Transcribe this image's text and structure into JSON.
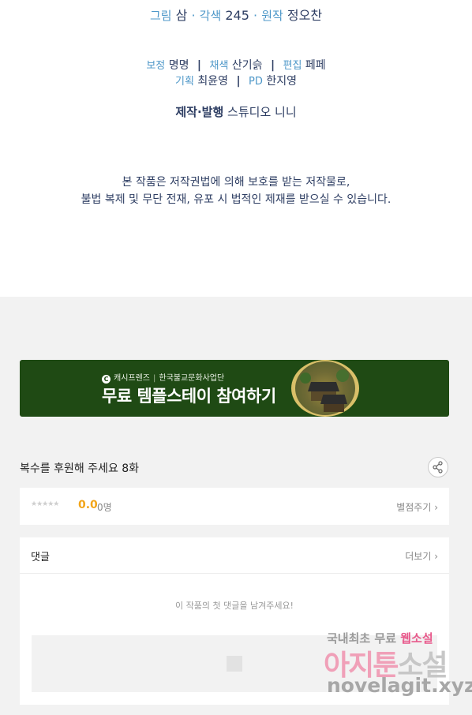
{
  "credits": {
    "art": {
      "label": "그림",
      "name": "삼"
    },
    "color": {
      "label": "각색",
      "name": "245"
    },
    "original": {
      "label": "원작",
      "name": "정오찬"
    },
    "sep_dot": "·",
    "assist": {
      "label": "보정",
      "name": "명명"
    },
    "colorist": {
      "label": "채색",
      "name": "산기슭"
    },
    "editor": {
      "label": "편집",
      "name": "페페"
    },
    "sep_bar": "|",
    "planning": {
      "label": "기획",
      "name": "최윤영"
    },
    "pd": {
      "label": "PD",
      "name": "한지영"
    },
    "production": {
      "label": "제작·발행",
      "name": "스튜디오 니니"
    },
    "copyright_line1": "본 작품은 저작권법에 의해 보호를 받는 저작물로,",
    "copyright_line2": "불법 복제 및 무단 전재, 유포 시 법적인 제재를 받으실 수 있습니다."
  },
  "banner": {
    "brand": "캐시프렌즈",
    "partner": "한국불교문화사업단",
    "sep": "|",
    "title": "무료 템플스테이 참여하기"
  },
  "episode": {
    "title": "복수를 후원해 주세요 8화"
  },
  "rating": {
    "stars": "★★★★★",
    "score": "0.0",
    "count": "0명",
    "rate_label": "별점주기 ›"
  },
  "comments": {
    "label": "댓글",
    "more_label": "더보기 ›",
    "empty_message": "이 작품의 첫 댓글을 남겨주세요!"
  },
  "watermark": {
    "line1_a": "국내최초 무료 ",
    "line1_b": "웹소설",
    "line2_a": "아지툰",
    "line2_b": "소설",
    "line3": "novelagit.xyz"
  },
  "colors": {
    "accent_label": "#4d97c8",
    "credit_text": "#2e3e63",
    "banner_bg": "#1f4a14",
    "score": "#f2a51a"
  }
}
